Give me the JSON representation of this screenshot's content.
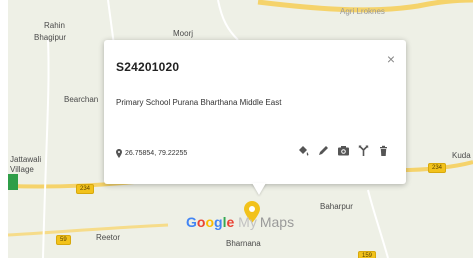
{
  "map": {
    "places": {
      "rahin": "Rahin",
      "bhagpur": "Bhagipur",
      "moorj": "Moorj",
      "bearchan": "Bearchan",
      "jattawali": "Jattawali",
      "village": "Village",
      "kud": "Kuda",
      "baharpur": "Baharpur",
      "reetor": "Reetor",
      "bharnana": "Bharnana",
      "top_faint_1": "",
      "top_faint_2": "Agri Lroknes"
    },
    "shields": {
      "shield_234_left": "234",
      "shield_234_right": "234",
      "shield_59": "59",
      "shield_159": "159"
    }
  },
  "popup": {
    "title": "S24201020",
    "description": "Primary School Purana Bharthana Middle East",
    "coordinates": "26.75854, 79.22255",
    "close_glyph": "×"
  },
  "brand": {
    "g1": "G",
    "o1": "o",
    "o2": "o",
    "g2": "g",
    "l": "l",
    "e": "e",
    "my": "My",
    "maps": "Maps"
  },
  "colors": {
    "map_bg": "#eef0e6",
    "highway": "#f5d36b",
    "accent_pin": "#f2c21b"
  }
}
